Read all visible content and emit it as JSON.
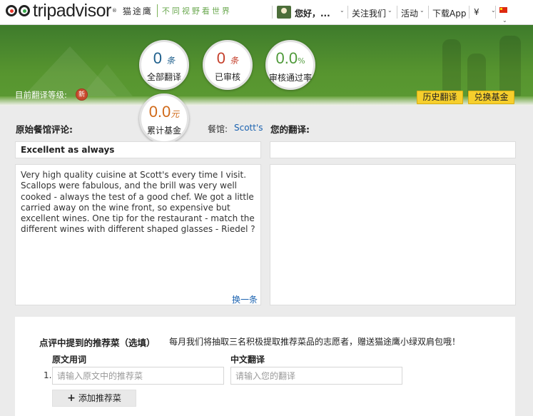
{
  "header": {
    "logo_text": "tripadvisor",
    "logo_tm": "®",
    "logo_cn": "猫途鹰",
    "slogan": "不同视野看世界",
    "greeting": "您好，...",
    "nav_follow": "关注我们",
    "nav_activity": "活动",
    "nav_download": "下载App",
    "nav_currency": "¥",
    "caret": "⌄"
  },
  "stats": {
    "all_translations": {
      "value": "0",
      "unit": "条",
      "label": "全部翻译"
    },
    "reviewed": {
      "value": "0",
      "unit": "条",
      "label": "已审核"
    },
    "pass_rate": {
      "value": "0.0",
      "unit": "%",
      "label": "审核通过率"
    },
    "fund": {
      "value": "0.0",
      "unit": "元",
      "label": "累计基金"
    },
    "colors": {
      "blue": "#1e5f8c",
      "red": "#c5402c",
      "green": "#4f9a3a",
      "orange": "#d06a1a"
    }
  },
  "level": {
    "label": "目前翻译等级:",
    "badge": "新"
  },
  "buttons": {
    "history": "历史翻译",
    "exchange": "兑换基金"
  },
  "review": {
    "section_title": "原始餐馆评论:",
    "restaurant_label": "餐馆:",
    "restaurant_name": "Scott's",
    "title": "Excellent as always",
    "body": "Very high quality cuisine at Scott's every time I visit. Scallops were fabulous, and the brill was very well cooked - always the test of a good chef. We got a little carried away on the wine front, so expensive but excellent wines. One tip for the restaurant - match the different wines with different shaped glasses - Riedel ?",
    "switch": "换一条"
  },
  "translation": {
    "section_title": "您的翻译:"
  },
  "dishes": {
    "title": "点评中提到的推荐菜（选填）",
    "note": "每月我们将抽取三名积极提取推荐菜品的志愿者，赠送猫途鹰小绿双肩包哦！",
    "col_original": "原文用词",
    "col_chinese": "中文翻译",
    "row_number": "1.",
    "original_placeholder": "请输入原文中的推荐菜",
    "chinese_placeholder": "请输入您的翻译",
    "add_label": "添加推荐菜",
    "add_symbol": "+"
  }
}
